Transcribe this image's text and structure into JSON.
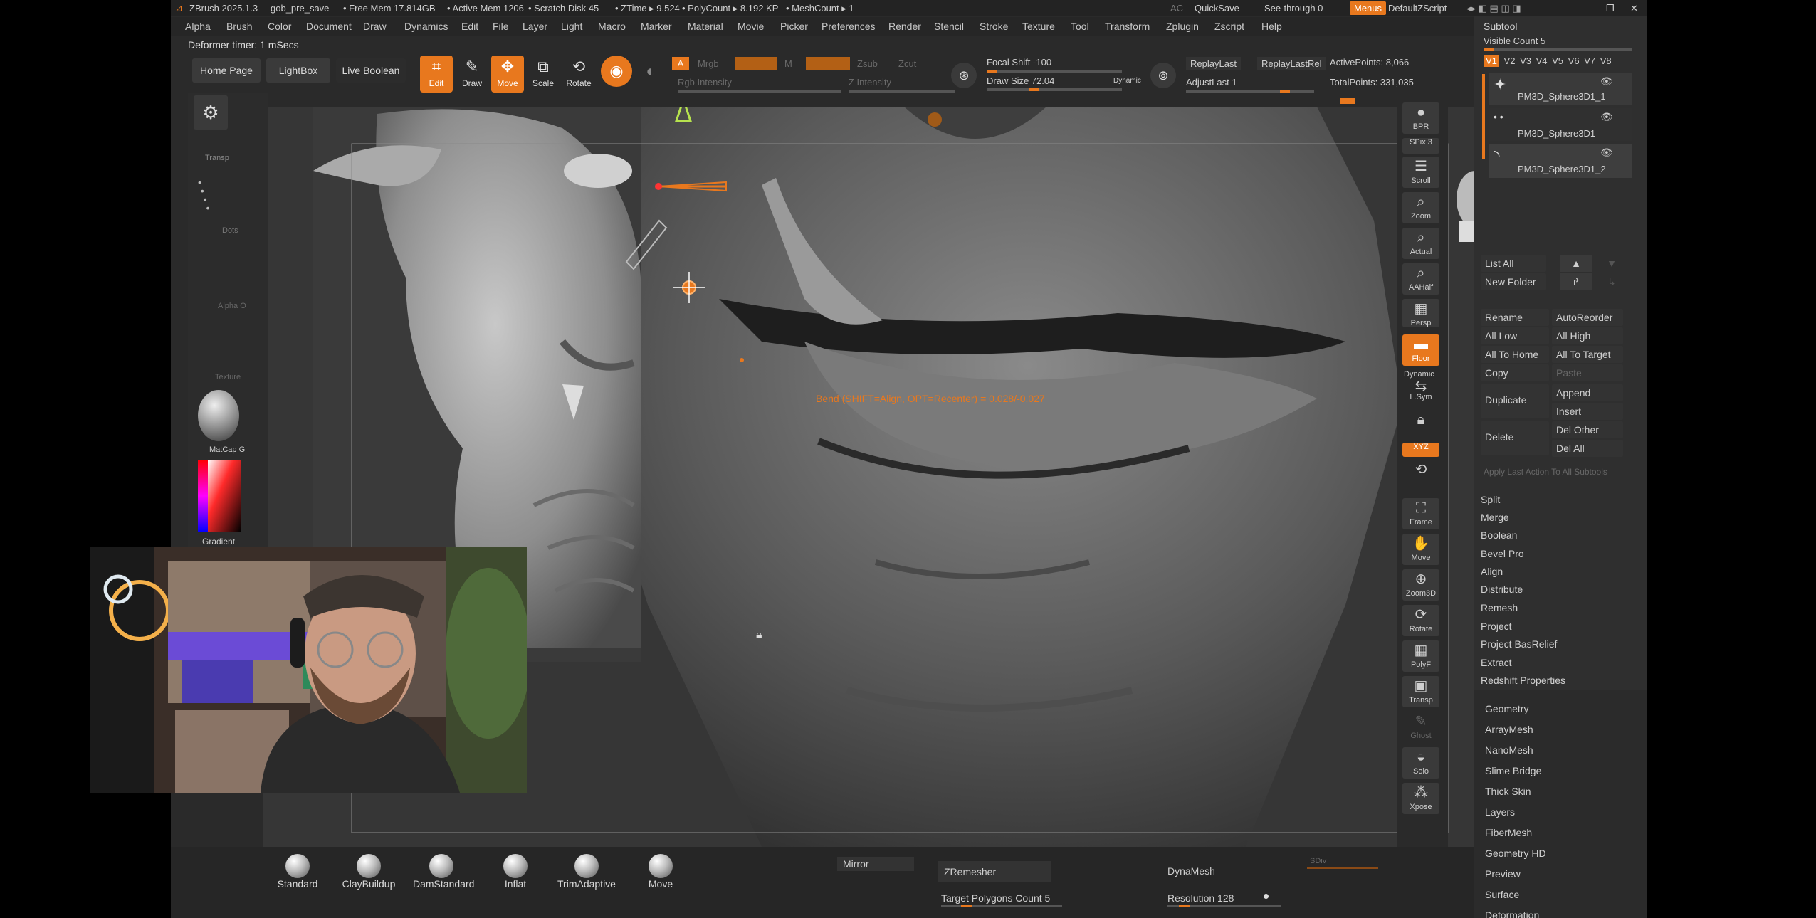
{
  "window": {
    "app_title": "ZBrush 2025.1.3",
    "project": "gob_pre_save",
    "free_mem": "• Free Mem 17.814GB",
    "active_mem": "• Active Mem 1206",
    "scratch_disk": "• Scratch Disk 45",
    "ztime": "• ZTime ▸ 9.524",
    "polycount": "• PolyCount ▸ 8.192 KP",
    "meshcount": "• MeshCount ▸ 1",
    "ac": "AC",
    "quicksave": "QuickSave",
    "see_through": "See-through  0",
    "menus": "Menus",
    "script": "DefaultZScript"
  },
  "menu": [
    "Alpha",
    "Brush",
    "Color",
    "Document",
    "Draw",
    "Dynamics",
    "Edit",
    "File",
    "Layer",
    "Light",
    "Macro",
    "Marker",
    "Material",
    "Movie",
    "Picker",
    "Preferences",
    "Render",
    "Stencil",
    "Stroke",
    "Texture",
    "Tool",
    "Transform",
    "Zplugin",
    "Zscript",
    "Help"
  ],
  "status": {
    "deformer": "Deformer timer: 1 mSecs"
  },
  "shelf": {
    "home_page": "Home Page",
    "lightbox": "LightBox",
    "live_boolean": "Live Boolean",
    "edit": "Edit",
    "draw": "Draw",
    "move": "Move",
    "scale": "Scale",
    "rotate": "Rotate",
    "a": "A",
    "mrgb": "Mrgb",
    "m": "M",
    "zsub": "Zsub",
    "zcut": "Zcut",
    "rgb_intensity": "Rgb Intensity",
    "z_intensity": "Z Intensity",
    "focal_shift": "Focal Shift -100",
    "draw_size": "Draw Size 72.04",
    "dynamic": "Dynamic",
    "replay_last": "ReplayLast",
    "replay_last_rel": "ReplayLastRel",
    "adjust_last": "AdjustLast 1",
    "active_points": "ActivePoints: 8,066",
    "total_points": "TotalPoints: 331,035",
    "draw_size_value": 0.35,
    "focal_shift_value": 0.0
  },
  "left_tray": {
    "transp": "Transp",
    "dots": "Dots",
    "alpha_off": "Alpha O",
    "texture_off": "Texture",
    "matcap": "MatCap G",
    "gradient": "Gradient"
  },
  "viewport": {
    "bend_hint": "Bend (SHIFT=Align, OPT=Recenter) = 0.028/-0.027"
  },
  "right_shelf": [
    {
      "name": "bpr",
      "label": "BPR"
    },
    {
      "name": "spix",
      "label": "SPix 3"
    },
    {
      "name": "scroll",
      "label": "Scroll"
    },
    {
      "name": "zoom",
      "label": "Zoom"
    },
    {
      "name": "actual",
      "label": "Actual"
    },
    {
      "name": "aahalf",
      "label": "AAHalf"
    },
    {
      "name": "persp",
      "label": "Persp"
    },
    {
      "name": "floor",
      "label": "Floor"
    },
    {
      "name": "lsym",
      "label": "L.Sym"
    },
    {
      "name": "xyz",
      "label": "XYZ"
    },
    {
      "name": "frame",
      "label": "Frame"
    },
    {
      "name": "move",
      "label": "Move"
    },
    {
      "name": "zoom3d",
      "label": "Zoom3D"
    },
    {
      "name": "rotate",
      "label": "Rotate"
    },
    {
      "name": "polyf",
      "label": "PolyF"
    },
    {
      "name": "transp",
      "label": "Transp"
    },
    {
      "name": "ghost",
      "label": "Ghost"
    },
    {
      "name": "solo",
      "label": "Solo"
    },
    {
      "name": "xpose",
      "label": "Xpose"
    }
  ],
  "right_shelf_extra": {
    "dynamic": "Dynamic"
  },
  "subtool": {
    "title": "Subtool",
    "visible_count": "Visible Count 5",
    "tabs": [
      "V1",
      "V2",
      "V3",
      "V4",
      "V5",
      "V6",
      "V7",
      "V8"
    ],
    "items": [
      "PM3D_Sphere3D1_1",
      "PM3D_Sphere3D1",
      "PM3D_Sphere3D1_2"
    ],
    "list_all": "List All",
    "new_folder": "New Folder",
    "rename": "Rename",
    "auto_reorder": "AutoReorder",
    "all_low": "All Low",
    "all_high": "All High",
    "all_to_home": "All To Home",
    "all_to_target": "All To Target",
    "copy": "Copy",
    "paste": "Paste",
    "duplicate": "Duplicate",
    "append": "Append",
    "insert": "Insert",
    "delete": "Delete",
    "del_other": "Del Other",
    "del_all": "Del All",
    "apply_last": "Apply Last Action To All Subtools",
    "actions": [
      "Split",
      "Merge",
      "Boolean",
      "Bevel Pro",
      "Align",
      "Distribute",
      "Remesh",
      "Project",
      "Project BasRelief",
      "Extract",
      "Redshift Properties"
    ]
  },
  "tool_sections": [
    "Geometry",
    "ArrayMesh",
    "NanoMesh",
    "Slime Bridge",
    "Thick Skin",
    "Layers",
    "FiberMesh",
    "Geometry HD",
    "Preview",
    "Surface",
    "Deformation"
  ],
  "bottom": {
    "brushes": [
      "Standard",
      "ClayBuildup",
      "DamStandard",
      "Inflat",
      "TrimAdaptive",
      "Move"
    ],
    "mirror": "Mirror",
    "zremesher": "ZRemesher",
    "target_polygons": "Target Polygons Count 5",
    "dynamesh": "DynaMesh",
    "sdiv": "SDiv",
    "resolution": "Resolution 128"
  }
}
